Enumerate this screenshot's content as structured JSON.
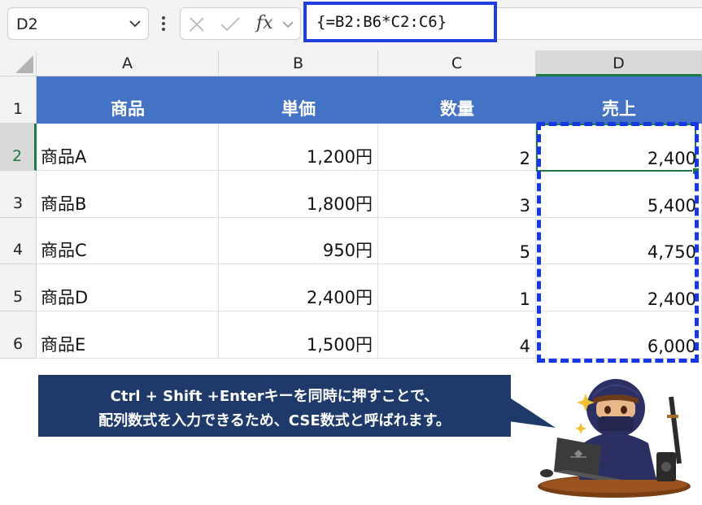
{
  "formula_bar": {
    "name_box": "D2",
    "fx_label": "fx",
    "formula": "{=B2:B6*C2:C6}"
  },
  "columns": [
    "A",
    "B",
    "C",
    "D"
  ],
  "rows": [
    "1",
    "2",
    "3",
    "4",
    "5",
    "6"
  ],
  "active_cell": "D2",
  "table": {
    "headers": [
      "商品",
      "単価",
      "数量",
      "売上"
    ],
    "rows": [
      [
        "商品A",
        "1,200円",
        "2",
        "2,400"
      ],
      [
        "商品B",
        "1,800円",
        "3",
        "5,400"
      ],
      [
        "商品C",
        "950円",
        "5",
        "4,750"
      ],
      [
        "商品D",
        "2,400円",
        "1",
        "2,400"
      ],
      [
        "商品E",
        "1,500円",
        "4",
        "6,000"
      ]
    ]
  },
  "callout": {
    "line1": "Ctrl + Shift +Enterキーを同時に押すことで、",
    "line2": "配列数式を入力できるため、CSE数式と呼ばれます。"
  },
  "colors": {
    "header_fill": "#4472c4",
    "selection_border": "#1637e8",
    "active_green": "#1e7a45",
    "callout_fill": "#1f3a6a"
  },
  "icons": [
    "chevron-down-icon",
    "more-vertical-icon",
    "cancel-x-icon",
    "check-icon",
    "function-fx-icon",
    "select-all-triangle-icon",
    "ninja-mascot-illustration"
  ]
}
